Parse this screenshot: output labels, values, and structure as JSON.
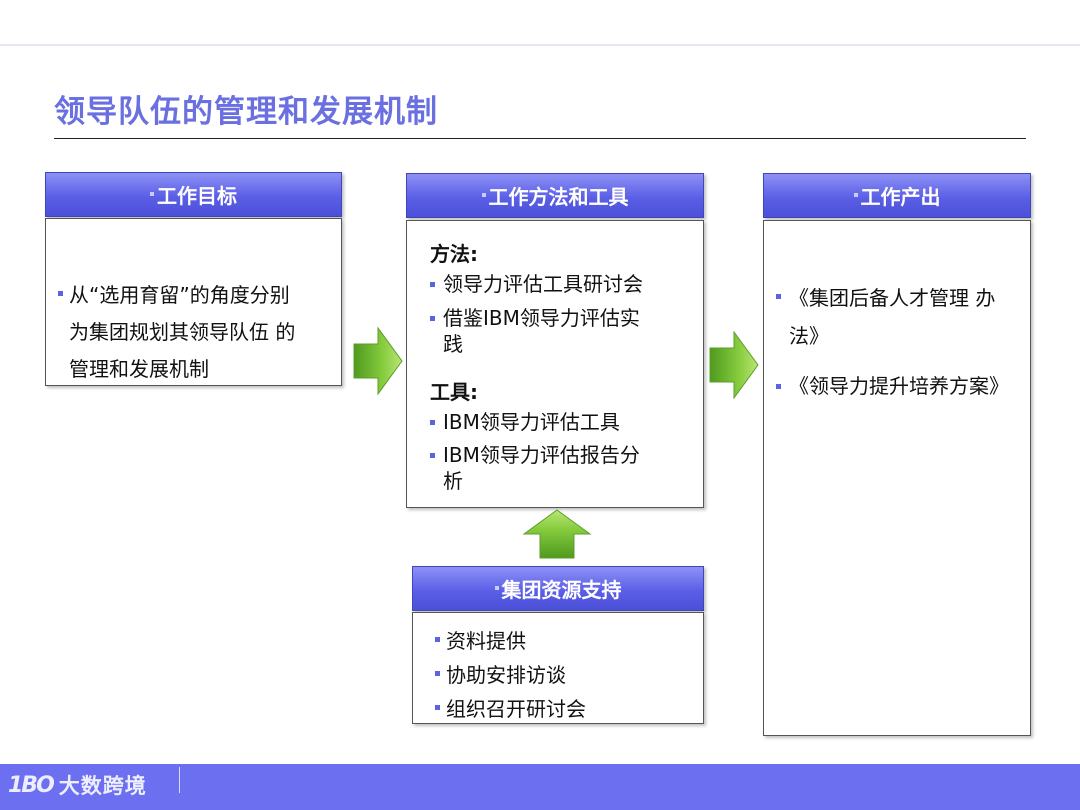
{
  "title": "领导队伍的管理和发展机制",
  "columns": {
    "goal": {
      "header": "工作目标",
      "items": [
        "从“选用育留”的角度分别为集团规划其领导队伍 的管理和发展机制"
      ],
      "lines": [
        "从“选用育留”的角度分别",
        "为集团规划其领导队伍  的",
        "管理和发展机制"
      ]
    },
    "method": {
      "header": "工作方法和工具",
      "methods_title": "方法:",
      "methods": [
        {
          "line1": "领导力评估工具研讨会",
          "line2": ""
        },
        {
          "line1": "借鉴IBM领导力评估实",
          "line2": "践"
        }
      ],
      "tools_title": "工具:",
      "tools": [
        {
          "line1": "IBM领导力评估工具",
          "line2": ""
        },
        {
          "line1": "IBM领导力评估报告分",
          "line2": "析"
        }
      ]
    },
    "output": {
      "header": "工作产出",
      "items": [
        {
          "line1": "《集团后备人才管理 办",
          "line2": "法》"
        },
        {
          "line1": "《领导力提升培养方案》",
          "line2": ""
        }
      ]
    }
  },
  "support": {
    "header": "集团资源支持",
    "items": [
      "资料提供",
      "协助安排访谈",
      "组织召开研讨会"
    ]
  },
  "footer": {
    "logo_mark": "1BO",
    "logo_text": "大数跨境"
  },
  "colors": {
    "header_blue": "#5b5fe6",
    "arrow_green": "#78c23a",
    "title_purple": "#6b70e0",
    "footer_bar": "#6b6ff0"
  }
}
